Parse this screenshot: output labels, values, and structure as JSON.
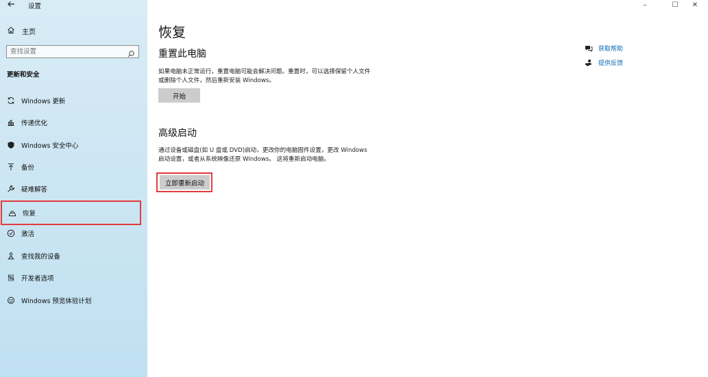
{
  "window": {
    "title": "设置",
    "controls": {
      "minimize": "–",
      "maximize": "☐",
      "close": "✕"
    }
  },
  "sidebar": {
    "home_label": "主页",
    "search_placeholder": "查找设置",
    "section_title": "更新和安全",
    "items": [
      {
        "label": "Windows 更新",
        "icon": "sync-icon"
      },
      {
        "label": "传递优化",
        "icon": "delivery-icon"
      },
      {
        "label": "Windows 安全中心",
        "icon": "shield-icon"
      },
      {
        "label": "备份",
        "icon": "backup-icon"
      },
      {
        "label": "疑难解答",
        "icon": "wrench-icon"
      },
      {
        "label": "恢复",
        "icon": "recovery-icon",
        "selected": true
      },
      {
        "label": "激活",
        "icon": "check-circle-icon"
      },
      {
        "label": "查找我的设备",
        "icon": "find-device-icon"
      },
      {
        "label": "开发者选项",
        "icon": "developer-icon"
      },
      {
        "label": "Windows 预览体验计划",
        "icon": "insider-icon"
      }
    ]
  },
  "main": {
    "title": "恢复",
    "reset": {
      "heading": "重置此电脑",
      "description": "如果电脑未正常运行，重置电脑可能会解决问题。重置时，可以选择保留个人文件或删除个人文件，然后重新安装 Windows。",
      "button": "开始"
    },
    "advanced": {
      "heading": "高级启动",
      "description": "通过设备或磁盘(如 U 盘或 DVD)启动，更改你的电脑固件设置，更改 Windows 启动设置，或者从系统映像还原 Windows。 这将重新启动电脑。",
      "button": "立即重新启动"
    }
  },
  "help": {
    "get_help": "获取帮助",
    "feedback": "提供反馈"
  },
  "colors": {
    "highlight": "#e23b3b",
    "link": "#0a67b5",
    "sidebar_bg": "#cde6f3",
    "button_bg": "#cccccc"
  }
}
